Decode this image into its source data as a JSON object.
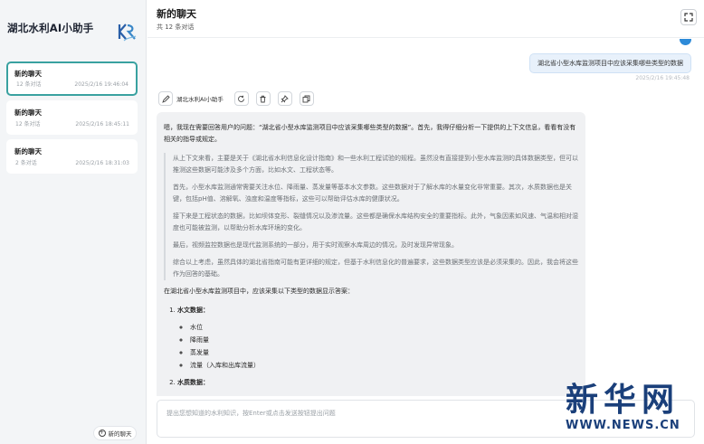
{
  "sidebar": {
    "app_title": "湖北水利AI小助手",
    "conversations": [
      {
        "title": "新的聊天",
        "count": "12 条对话",
        "date": "2025/2/16 19:46:04"
      },
      {
        "title": "新的聊天",
        "count": "12 条对话",
        "date": "2025/2/16 18:45:11"
      },
      {
        "title": "新的聊天",
        "count": "2 条对话",
        "date": "2025/2/16 18:31:03"
      }
    ],
    "new_chat_label": "新的聊天"
  },
  "header": {
    "title": "新的聊天",
    "subtitle": "共 12 条对话"
  },
  "messages": {
    "user": {
      "text": "湖北省小型水库监测项目中应该采集哪些类型的数据",
      "time": "2025/2/16 19:45:48"
    },
    "bot": {
      "name": "湖北水利AI小助手",
      "lead": "嗯，我现在需要回答用户的问题：“湖北省小型水库监测项目中应该采集哪些类型的数据”。首先，我得仔细分析一下提供的上下文信息，看看有没有相关的指导或规定。",
      "quote": [
        "从上下文来看，主要是关于《湖北省水利信息化设计指南》和一些水利工程试验的规程。虽然没有直接提到小型水库监测的具体数据类型，但可以推测这些数据可能涉及多个方面，比如水文、工程状态等。",
        "首先，小型水库监测通常需要关注水位、降雨量、蒸发量等基本水文参数。这些数据对于了解水库的水量变化非常重要。其次，水质数据也是关键，包括pH值、溶解氧、浊度和温度等指标，这些可以帮助评估水库的健康状况。",
        "接下来是工程状态的数据，比如坝体变形、裂缝情况以及渗流量。这些都是确保水库结构安全的重要指标。此外，气象因素如风速、气温和相对湿度也可能被监测，以帮助分析水库环境的变化。",
        "最后，视频监控数据也是现代监测系统的一部分，用于实时观察水库周边的情况，及时发现异常现象。",
        "综合以上考虑，虽然具体的湖北省指南可能有更详细的规定，但基于水利信息化的普遍要求，这些数据类型应该是必须采集的。因此，我会将这些作为回答的基础。"
      ],
      "answer_intro": "在湖北省小型水库监测项目中，应该采集以下类型的数据显示答案：",
      "sections": [
        {
          "title": "水文数据：",
          "items": [
            "水位",
            "降雨量",
            "蒸发量",
            "流量（入库和出库流量）"
          ]
        },
        {
          "title": "水质数据：",
          "items": []
        }
      ]
    }
  },
  "input": {
    "placeholder": "提出您想知道的水利知识，按Enter或点击发送按钮提出问题"
  },
  "watermark": {
    "big": "新华网",
    "small": "WWW.NEWS.CN"
  }
}
